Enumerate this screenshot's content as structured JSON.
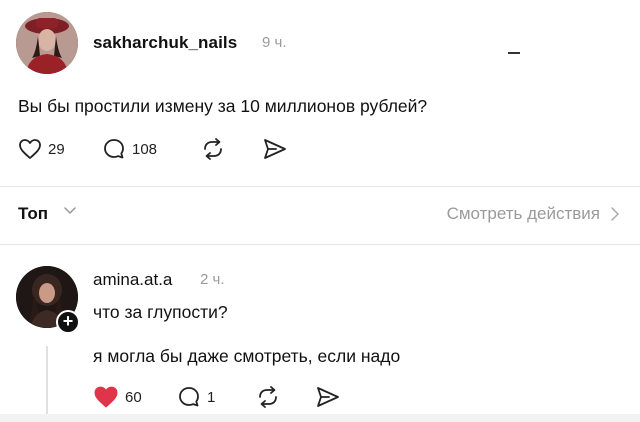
{
  "post": {
    "author": "sakharchuk_nails",
    "time": "9 ч.",
    "text": "Вы бы простили измену за 10 миллионов рублей?",
    "likes": "29",
    "comments": "108",
    "icons": [
      "heart-icon",
      "comment-icon",
      "repost-icon",
      "share-icon"
    ]
  },
  "replies_bar": {
    "sort_label": "Топ",
    "view_actions_label": "Смотреть действия"
  },
  "reply": {
    "author": "amina.at.a",
    "time": "2 ч.",
    "text_1": "что за глупости?",
    "text_2": "я могла бы даже смотреть, если надо",
    "likes": "60",
    "comments": "1",
    "liked": true,
    "like_color": "#e0344a"
  }
}
